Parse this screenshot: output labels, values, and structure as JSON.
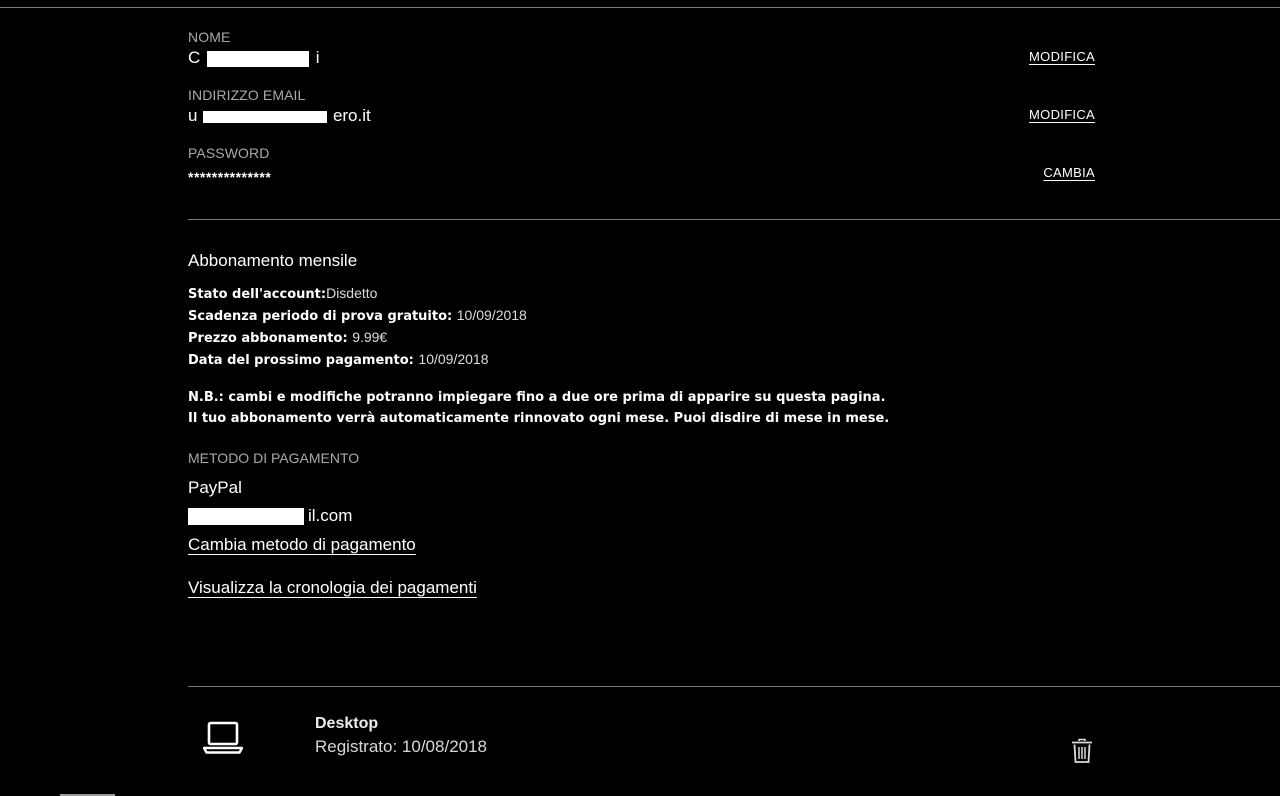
{
  "account": {
    "name": {
      "label": "NOME",
      "value_start": "C",
      "value_end": "i",
      "action": "MODIFICA"
    },
    "email": {
      "label": "INDIRIZZO EMAIL",
      "value_start": "u",
      "value_end": "ero.it",
      "action": "MODIFICA"
    },
    "password": {
      "label": "PASSWORD",
      "value": "**************",
      "action": "CAMBIA"
    }
  },
  "subscription": {
    "title": "Abbonamento mensile",
    "details": [
      {
        "key": "Stato dell'account:",
        "value": "Disdetto"
      },
      {
        "key": "Scadenza periodo di prova gratuito: ",
        "value": "10/09/2018"
      },
      {
        "key": "Prezzo abbonamento: ",
        "value": "9.99€"
      },
      {
        "key": "Data del prossimo pagamento: ",
        "value": "10/09/2018"
      }
    ],
    "notes": [
      "N.B.: cambi e modifiche potranno impiegare fino a due ore prima di apparire su questa pagina.",
      "Il tuo abbonamento verrà automaticamente rinnovato ogni mese. Puoi disdire di mese in mese."
    ]
  },
  "payment": {
    "label": "METODO DI PAGAMENTO",
    "method": "PayPal",
    "email_end": "il.com",
    "change_link": "Cambia metodo di pagamento",
    "history_link": "Visualizza la cronologia dei pagamenti"
  },
  "device": {
    "icon": "laptop-icon",
    "name": "Desktop",
    "registered": "Registrato: 10/08/2018",
    "delete_icon": "trash-icon"
  }
}
